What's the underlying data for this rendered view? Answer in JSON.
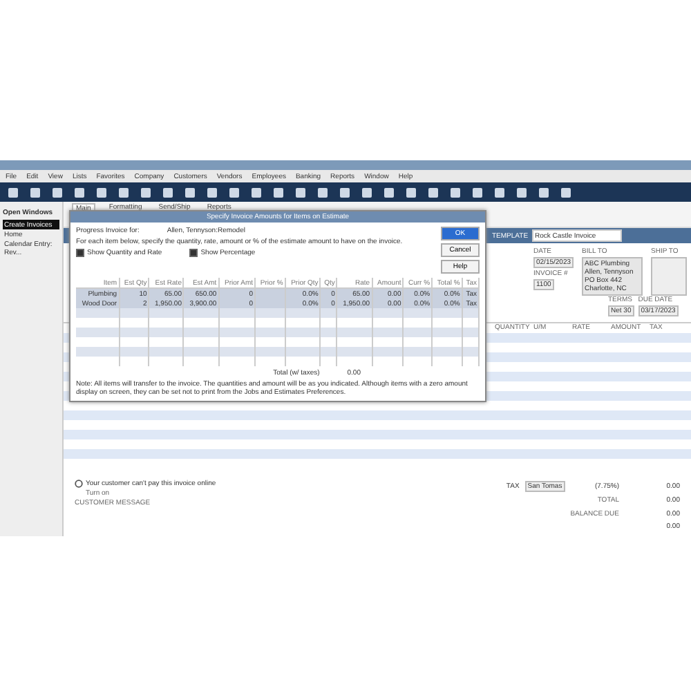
{
  "menu": [
    "File",
    "Edit",
    "View",
    "Lists",
    "Favorites",
    "Company",
    "Customers",
    "Vendors",
    "Employees",
    "Banking",
    "Reports",
    "Window",
    "Help"
  ],
  "open_windows": {
    "title": "Open Windows",
    "items": [
      {
        "label": "Create Invoices",
        "selected": true
      },
      {
        "label": "Home",
        "selected": false
      },
      {
        "label": "Calendar Entry: Rev...",
        "selected": false
      }
    ]
  },
  "tabs": [
    {
      "label": "Main",
      "selected": true
    },
    {
      "label": "Formatting",
      "selected": false
    },
    {
      "label": "Send/Ship",
      "selected": false
    },
    {
      "label": "Reports",
      "selected": false
    }
  ],
  "header": {
    "template_label": "TEMPLATE",
    "template": "Rock Castle Invoice"
  },
  "form": {
    "date_label": "DATE",
    "date": "02/15/2023",
    "invoice_label": "INVOICE #",
    "invoice": "1100",
    "bill_to_label": "BILL TO",
    "bill_to": [
      "ABC Plumbing",
      "Allen, Tennyson",
      "PO Box 442",
      "Charlotte, NC"
    ],
    "ship_to_label": "SHIP TO",
    "terms_label": "TERMS",
    "terms": "Net 30",
    "due_label": "DUE DATE",
    "due": "03/17/2023"
  },
  "table": {
    "columns": [
      "QUANTITY",
      "U/M",
      "RATE",
      "AMOUNT",
      "TAX"
    ]
  },
  "footer": {
    "message": "Your customer can't pay this invoice online",
    "message_sub": "Turn on",
    "memo": "CUSTOMER MESSAGE",
    "tax_label": "TAX",
    "tax": "San Tomas",
    "tax_rate": "(7.75%)",
    "total_label": "TOTAL",
    "balance_label": "BALANCE DUE",
    "amounts": [
      "0.00",
      "0.00",
      "0.00",
      "0.00"
    ]
  },
  "dialog": {
    "title": "Specify Invoice Amounts for Items on Estimate",
    "for_label": "Progress Invoice for:",
    "for": "Allen, Tennyson:Remodel",
    "instructions": "For each item below, specify the quantity, rate, amount or % of the estimate amount to have on the invoice.",
    "options": [
      {
        "label": "Show Quantity and Rate",
        "checked": true
      },
      {
        "label": "Show Percentage",
        "checked": true
      }
    ],
    "buttons": [
      "OK",
      "Cancel",
      "Help"
    ],
    "columns": [
      "Item",
      "Est Qty",
      "Est Rate",
      "Est Amt",
      "Prior Amt",
      "Prior %",
      "Prior Qty",
      "Qty",
      "Rate",
      "Amount",
      "Curr %",
      "Total %",
      "Tax"
    ],
    "rows": [
      [
        "Plumbing",
        "10",
        "65.00",
        "650.00",
        "0",
        "",
        "0.0%",
        "0",
        "65.00",
        "0.00",
        "0.0%",
        "0.0%",
        "Tax"
      ],
      [
        "Wood Door",
        "2",
        "1,950.00",
        "3,900.00",
        "0",
        "",
        "0.0%",
        "0",
        "1,950.00",
        "0.00",
        "0.0%",
        "0.0%",
        "Tax"
      ]
    ],
    "total_label": "Total (w/ taxes)",
    "total": "0.00",
    "note": "Note: All items will transfer to the invoice. The quantities and amount will be as you indicated. Although items with a zero amount display on screen, they can be set not to print from the Jobs and Estimates Preferences."
  }
}
